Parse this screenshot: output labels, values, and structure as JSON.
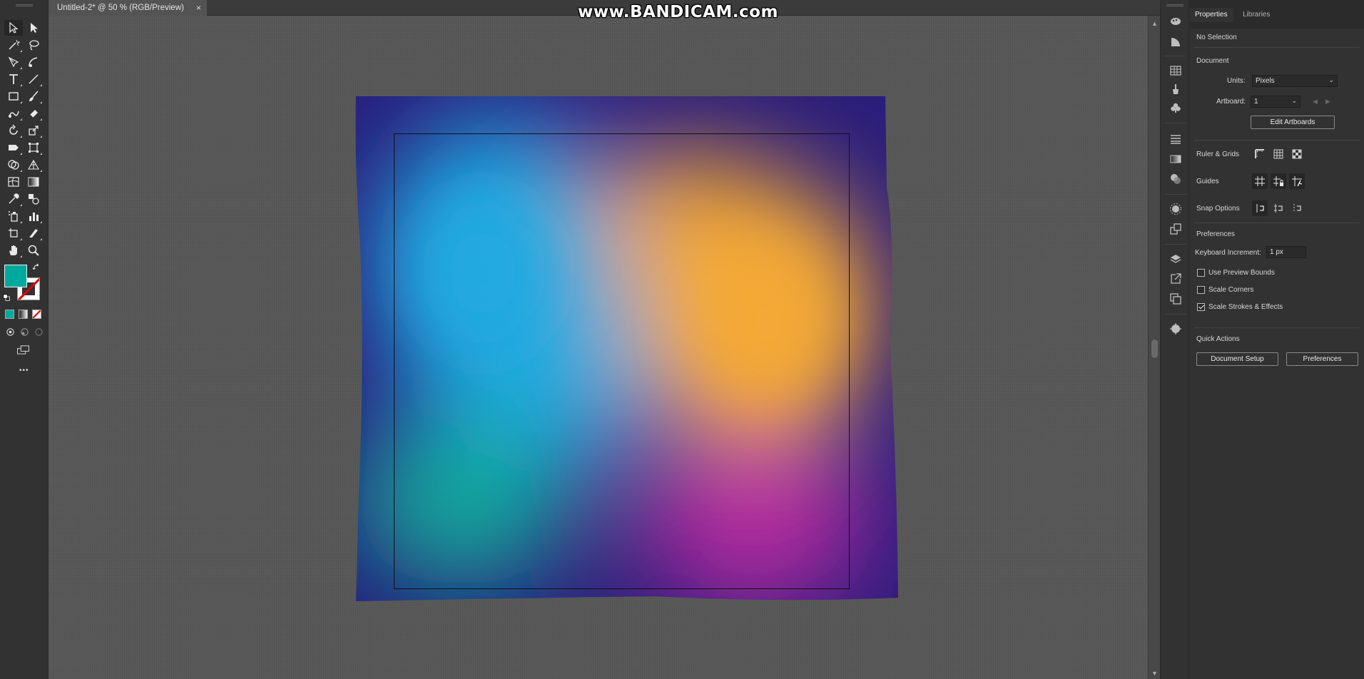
{
  "document_tab": {
    "title": "Untitled-2* @ 50 % (RGB/Preview)",
    "close": "×"
  },
  "watermark": "www.BANDICAM.com",
  "toolbar": {
    "fill_color": "#00a99d",
    "more_label": "•••",
    "tools": [
      "selection-tool",
      "direct-selection-tool",
      "magic-wand-tool",
      "lasso-tool",
      "pen-tool",
      "curvature-tool",
      "type-tool",
      "line-segment-tool",
      "rectangle-tool",
      "paintbrush-tool",
      "shaper-tool",
      "eraser-tool",
      "rotate-tool",
      "scale-tool",
      "width-tool",
      "free-transform-tool",
      "shape-builder-tool",
      "perspective-grid-tool",
      "mesh-tool",
      "gradient-tool",
      "eyedropper-tool",
      "blend-tool",
      "symbol-sprayer-tool",
      "column-graph-tool",
      "artboard-tool",
      "slice-tool",
      "hand-tool",
      "zoom-tool"
    ]
  },
  "canvas": {
    "artwork_colors": {
      "border": "#25187a",
      "blue": "#1fa9e1",
      "orange": "#f5a830",
      "teal": "#0aa89a",
      "magenta": "#b5259e"
    }
  },
  "panel": {
    "tabs": {
      "properties": "Properties",
      "libraries": "Libraries"
    },
    "selection_status": "No Selection",
    "document": {
      "heading": "Document",
      "units_label": "Units:",
      "units_value": "Pixels",
      "artboard_label": "Artboard:",
      "artboard_value": "1",
      "edit_artboards": "Edit Artboards"
    },
    "ruler_grids": "Ruler & Grids",
    "guides": "Guides",
    "snap_options": "Snap Options",
    "preferences": {
      "heading": "Preferences",
      "keyboard_increment_label": "Keyboard Increment:",
      "keyboard_increment_value": "1 px",
      "use_preview_bounds": "Use Preview Bounds",
      "use_preview_bounds_checked": false,
      "scale_corners": "Scale Corners",
      "scale_corners_checked": false,
      "scale_strokes_effects": "Scale Strokes & Effects",
      "scale_strokes_effects_checked": true
    },
    "quick_actions": {
      "heading": "Quick Actions",
      "document_setup": "Document Setup",
      "preferences_button": "Preferences"
    }
  }
}
